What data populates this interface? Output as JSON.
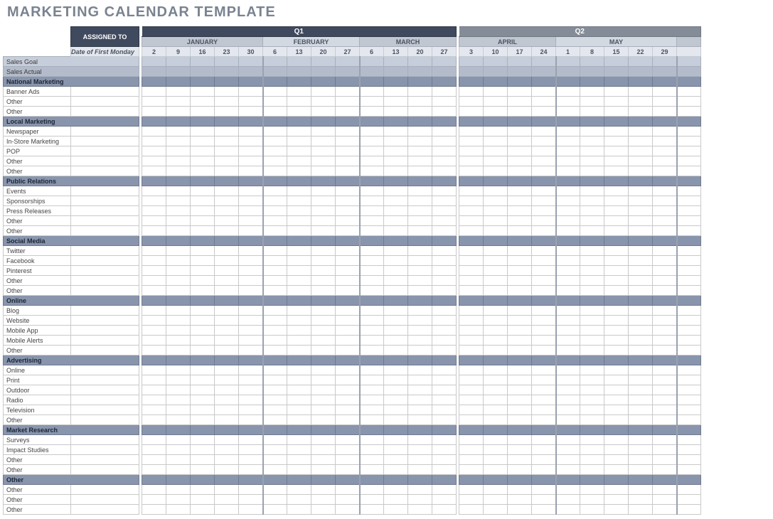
{
  "title": "MARKETING CALENDAR TEMPLATE",
  "headers": {
    "assigned": "ASSIGNED TO",
    "dateLabel": "Date of First Monday"
  },
  "quarters": [
    {
      "label": "Q1",
      "class": "q1",
      "months": [
        {
          "label": "JANUARY",
          "weeks": [
            "2",
            "9",
            "16",
            "23",
            "30"
          ]
        },
        {
          "label": "FEBRUARY",
          "weeks": [
            "6",
            "13",
            "20",
            "27"
          ]
        },
        {
          "label": "MARCH",
          "weeks": [
            "6",
            "13",
            "20",
            "27"
          ]
        }
      ]
    },
    {
      "label": "Q2",
      "class": "",
      "months": [
        {
          "label": "APRIL",
          "weeks": [
            "3",
            "10",
            "17",
            "24"
          ]
        },
        {
          "label": "MAY",
          "weeks": [
            "1",
            "8",
            "15",
            "22",
            "29"
          ]
        },
        {
          "label": "",
          "weeks": [
            ""
          ]
        }
      ]
    }
  ],
  "salesRows": [
    {
      "label": "Sales Goal"
    },
    {
      "label": "Sales Actual"
    }
  ],
  "sections": [
    {
      "name": "National Marketing",
      "items": [
        "Banner Ads",
        "Other",
        "Other"
      ]
    },
    {
      "name": "Local Marketing",
      "items": [
        "Newspaper",
        "In-Store Marketing",
        "POP",
        "Other",
        "Other"
      ]
    },
    {
      "name": "Public Relations",
      "items": [
        "Events",
        "Sponsorships",
        "Press Releases",
        "Other",
        "Other"
      ]
    },
    {
      "name": "Social Media",
      "items": [
        "Twitter",
        "Facebook",
        "Pinterest",
        "Other",
        "Other"
      ]
    },
    {
      "name": "Online",
      "items": [
        "Blog",
        "Website",
        "Mobile App",
        "Mobile Alerts",
        "Other"
      ]
    },
    {
      "name": "Advertising",
      "items": [
        "Online",
        "Print",
        "Outdoor",
        "Radio",
        "Television",
        "Other"
      ]
    },
    {
      "name": "Market Research",
      "items": [
        "Surveys",
        "Impact Studies",
        "Other",
        "Other"
      ]
    },
    {
      "name": "Other",
      "items": [
        "Other",
        "Other",
        "Other"
      ]
    }
  ]
}
